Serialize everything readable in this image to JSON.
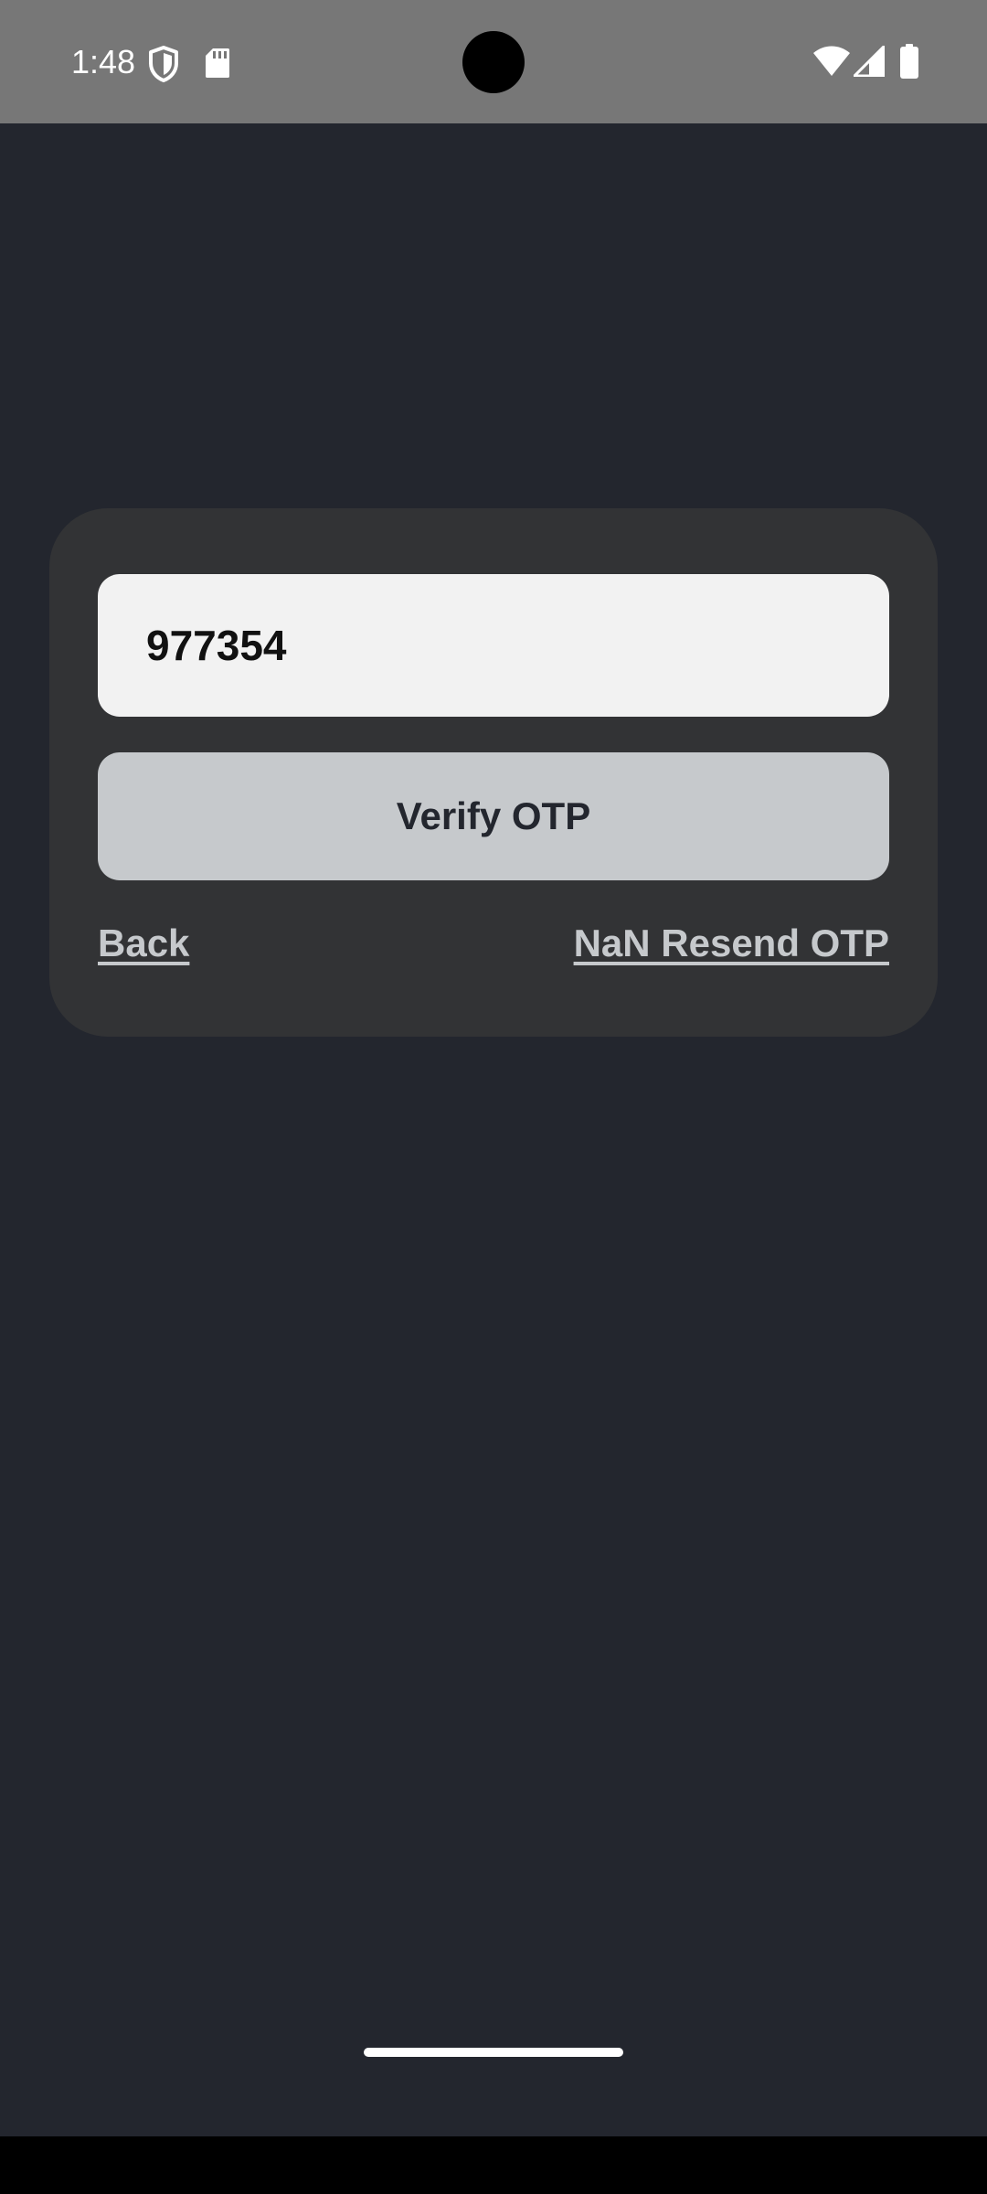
{
  "status_bar": {
    "time": "1:48",
    "left_icons": [
      "shield-icon",
      "sd-card-icon"
    ],
    "right_icons": [
      "wifi-icon",
      "cellular-signal-icon",
      "battery-icon"
    ]
  },
  "otp_form": {
    "otp_value": "977354",
    "verify_label": "Verify OTP",
    "back_label": "Back",
    "resend_label": "NaN Resend OTP"
  },
  "colors": {
    "background": "#23262e",
    "card": "#323335",
    "input": "#f2f2f2",
    "button": "#c6c9cc",
    "status_bar": "#777777"
  }
}
